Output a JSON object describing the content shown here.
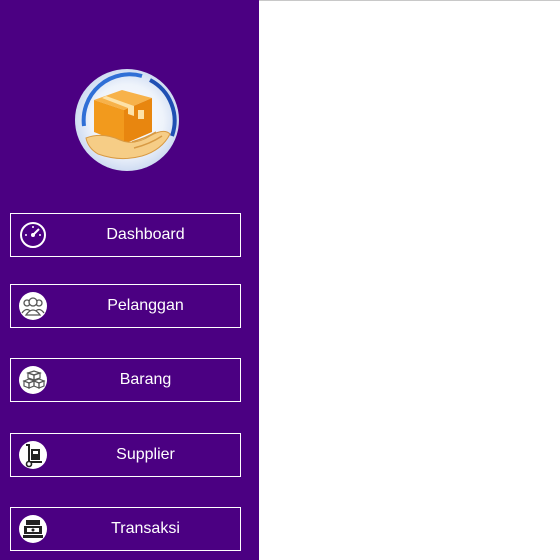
{
  "sidebar": {
    "logo_icon": "delivery-box-logo-icon",
    "items": [
      {
        "label": "Dashboard",
        "icon": "speedometer-icon"
      },
      {
        "label": "Pelanggan",
        "icon": "users-group-icon"
      },
      {
        "label": "Barang",
        "icon": "boxes-icon"
      },
      {
        "label": "Supplier",
        "icon": "hand-truck-icon"
      },
      {
        "label": "Transaksi",
        "icon": "cash-register-icon"
      }
    ]
  },
  "colors": {
    "sidebar_bg": "#4b0082",
    "button_border": "#ffffff",
    "content_bg": "#ffffff"
  }
}
